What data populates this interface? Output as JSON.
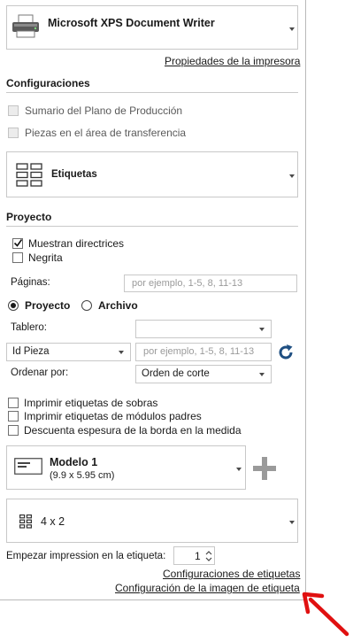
{
  "printer": {
    "name": "Microsoft XPS Document Writer",
    "properties_link": "Propiedades de la impresora"
  },
  "configuraciones": {
    "title": "Configuraciones",
    "options": [
      {
        "label": "Sumario del Plano de Producción",
        "checked": false
      },
      {
        "label": "Piezas en el área de transferencia",
        "checked": false
      }
    ],
    "report_select": "Etiquetas"
  },
  "proyecto": {
    "title": "Proyecto",
    "muestran_directrices": "Muestran directrices",
    "negrita": "Negrita",
    "paginas_label": "Páginas:",
    "paginas_placeholder": "por ejemplo, 1-5, 8, 11-13",
    "radio_proyecto": "Proyecto",
    "radio_archivo": "Archivo",
    "tablero_label": "Tablero:",
    "tablero_value": "",
    "id_select": "Id Pieza",
    "id_placeholder": "por ejemplo, 1-5, 8, 11-13",
    "ordenar_label": "Ordenar por:",
    "ordenar_value": "Orden de corte",
    "print_options": [
      "Imprimir etiquetas de sobras",
      "Imprimir etiquetas de módulos padres",
      "Descuenta espesura de la borda en la medida"
    ],
    "modelo_name": "Modelo 1",
    "modelo_size": "(9.9 x 5.95 cm)",
    "layout_value": "4 x 2",
    "start_label": "Empezar impression en la etiqueta:",
    "start_value": "1",
    "config_link": "Configuraciones de etiquetas",
    "image_link": "Configuración de la imagen de etiqueta"
  },
  "colors": {
    "arrow": "#e01010",
    "refresh": "#1f4f82",
    "plus": "#9a9a9a"
  }
}
